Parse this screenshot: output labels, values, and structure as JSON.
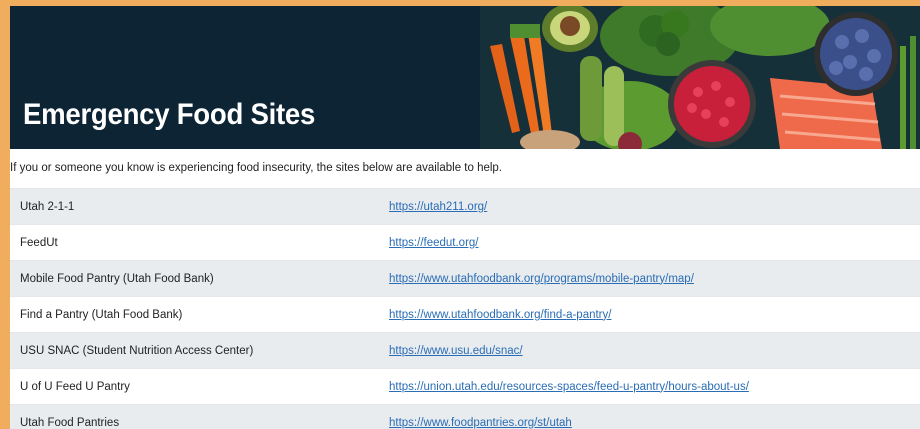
{
  "page": {
    "title": "Emergency Food Sites",
    "intro": "If you or someone you know is experiencing food insecurity, the sites below are available to help."
  },
  "hero": {
    "image_description_icons": [
      "carrot-icon",
      "avocado-icon",
      "blueberry-bowl-icon",
      "pomegranate-bowl-icon",
      "salmon-icon",
      "broccoli-icon"
    ],
    "colors": {
      "background": "#0c2433",
      "carrot": "#ec6a1c",
      "salmon": "#ef6a4b",
      "blueberry": "#3b4f8a",
      "pomegranate": "#c81f3a",
      "greens": "#5c9b2f"
    }
  },
  "sites": [
    {
      "name": "Utah 2-1-1",
      "url": "https://utah211.org/"
    },
    {
      "name": "FeedUt",
      "url": "https://feedut.org/"
    },
    {
      "name": "Mobile Food Pantry (Utah Food Bank)",
      "url": "https://www.utahfoodbank.org/programs/mobile-pantry/map/"
    },
    {
      "name": "Find a Pantry (Utah Food Bank)",
      "url": "https://www.utahfoodbank.org/find-a-pantry/"
    },
    {
      "name": "USU SNAC (Student Nutrition Access Center)",
      "url": "https://www.usu.edu/snac/"
    },
    {
      "name": "U of U Feed U Pantry",
      "url": "https://union.utah.edu/resources-spaces/feed-u-pantry/hours-about-us/"
    },
    {
      "name": "Utah Food Pantries",
      "url": "https://www.foodpantries.org/st/utah"
    }
  ],
  "colors": {
    "outer_background": "#f0ad5e",
    "row_stripe": "#e9ecef",
    "link": "#2a6db5"
  }
}
